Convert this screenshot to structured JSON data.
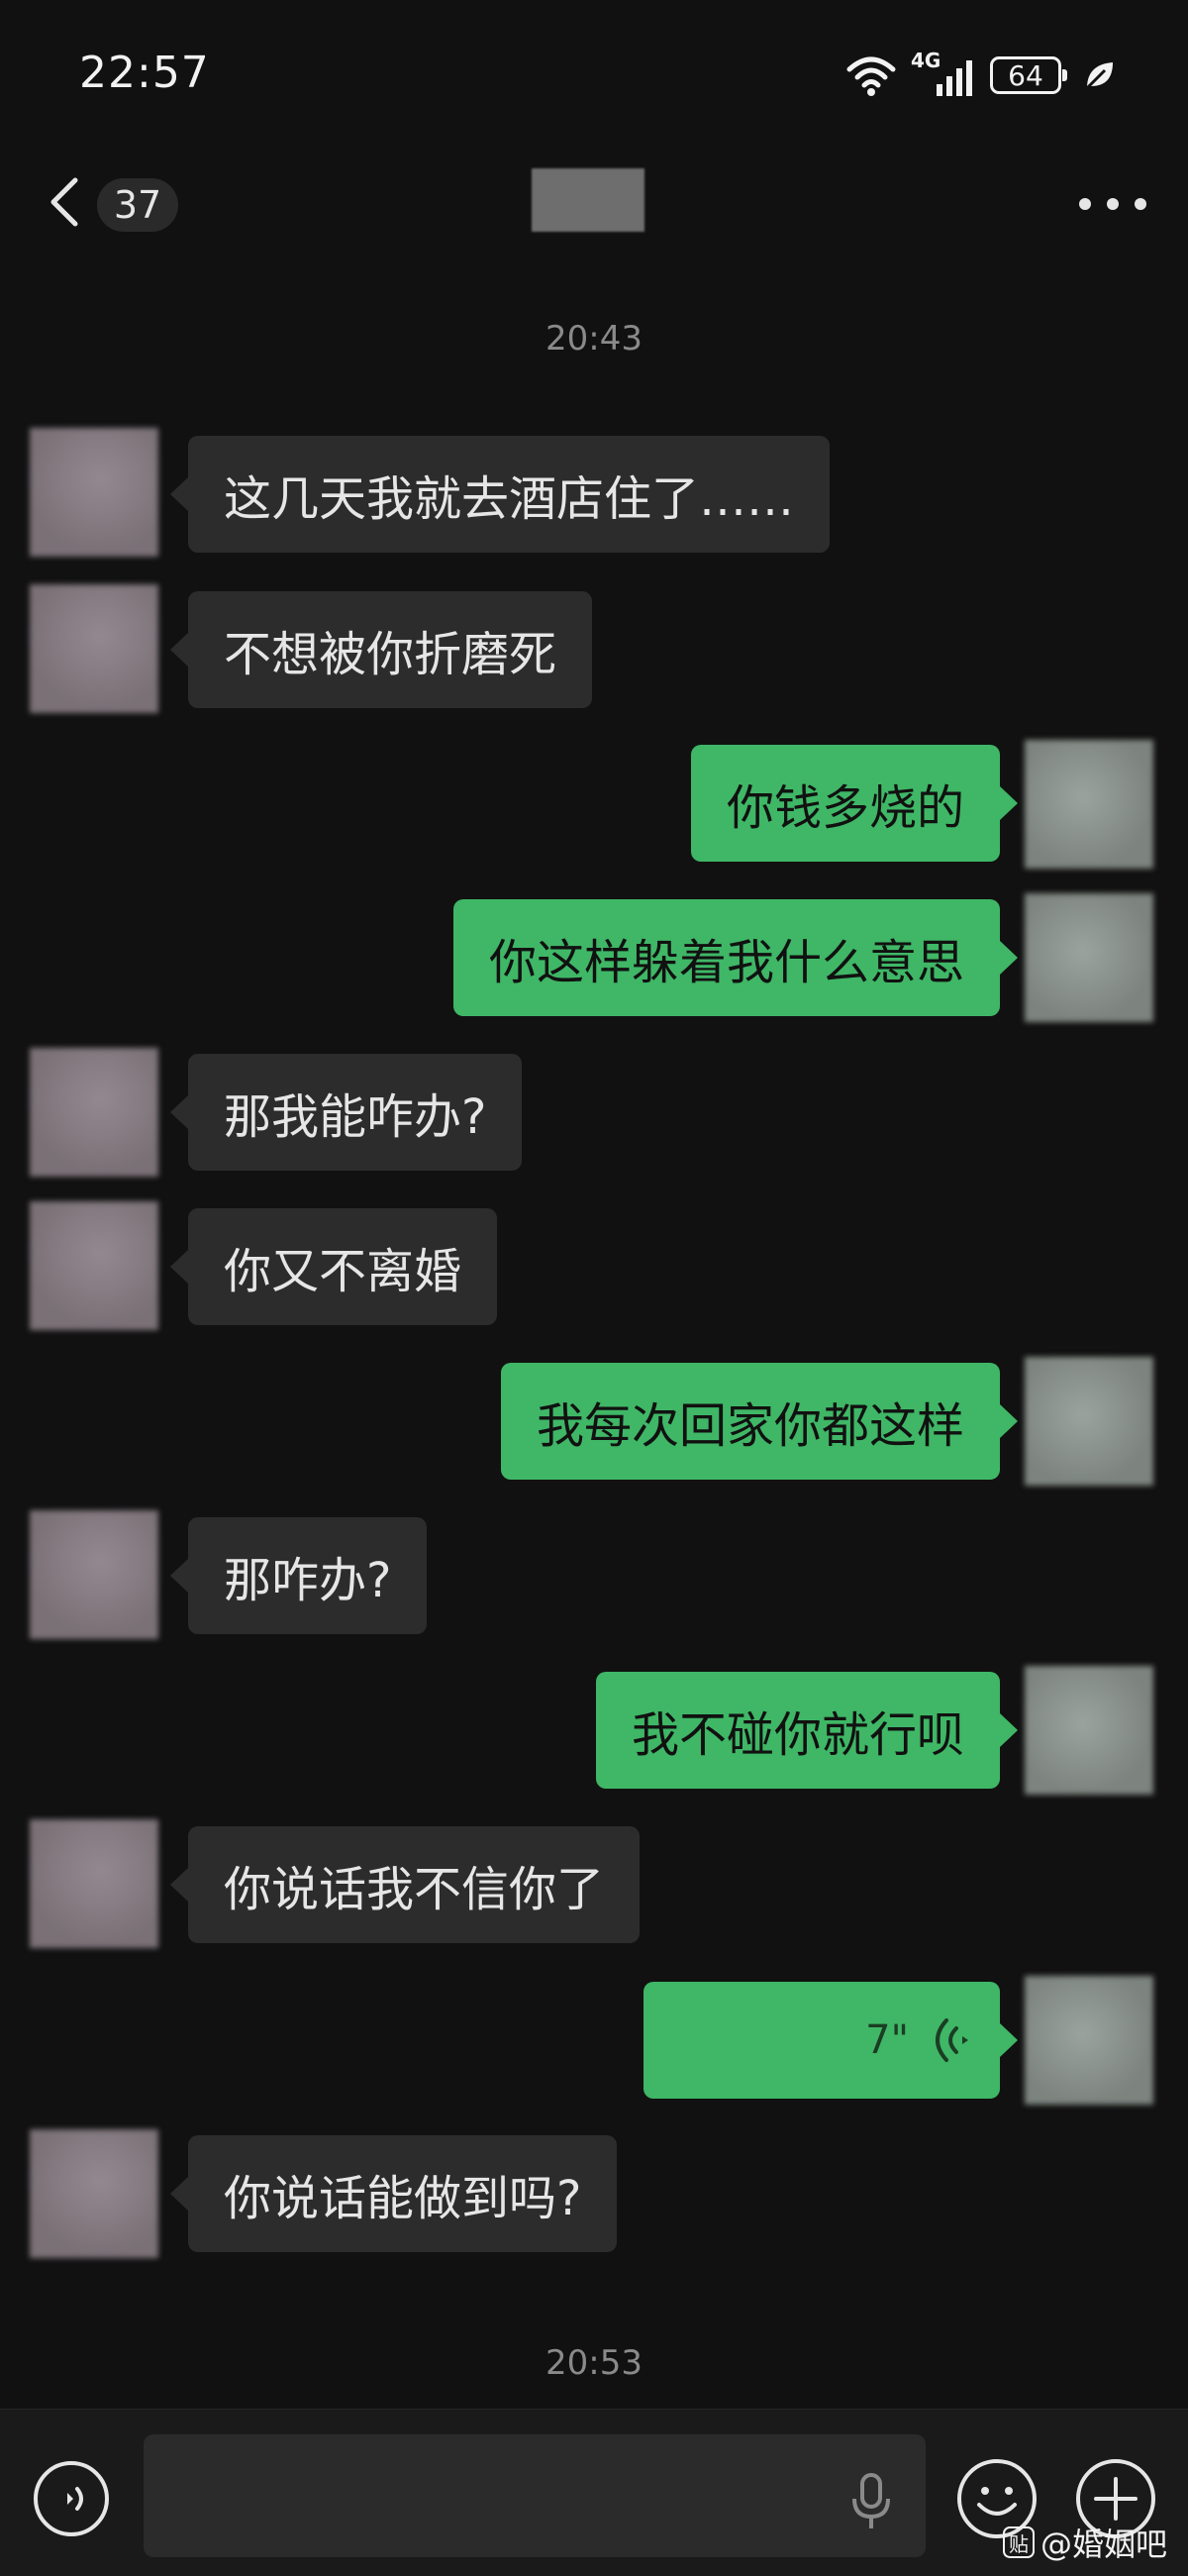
{
  "status_bar": {
    "time": "22:57",
    "network": "4G",
    "battery": "64"
  },
  "nav": {
    "unread_count": "37"
  },
  "timestamps": [
    "20:43",
    "20:53"
  ],
  "messages": [
    {
      "side": "left",
      "text": "这几天我就去酒店住了……"
    },
    {
      "side": "left",
      "text": "不想被你折磨死"
    },
    {
      "side": "right",
      "text": "你钱多烧的"
    },
    {
      "side": "right",
      "text": "你这样躲着我什么意思"
    },
    {
      "side": "left",
      "text": "那我能咋办?"
    },
    {
      "side": "left",
      "text": "你又不离婚"
    },
    {
      "side": "right",
      "text": "我每次回家你都这样"
    },
    {
      "side": "left",
      "text": "那咋办?"
    },
    {
      "side": "right",
      "text": "我不碰你就行呗"
    },
    {
      "side": "left",
      "text": "你说话我不信你了"
    },
    {
      "side": "right",
      "type": "voice",
      "duration": "7\""
    },
    {
      "side": "left",
      "text": "你说话能做到吗?"
    }
  ],
  "watermark": {
    "badge": "贴",
    "text": "@婚姻吧"
  },
  "icons": [
    "back-icon",
    "more-icon",
    "wifi-icon",
    "signal-icon",
    "battery-icon",
    "leaf-icon",
    "voice-wave-icon",
    "voice-toggle-icon",
    "mic-icon",
    "emoji-icon",
    "plus-icon"
  ]
}
